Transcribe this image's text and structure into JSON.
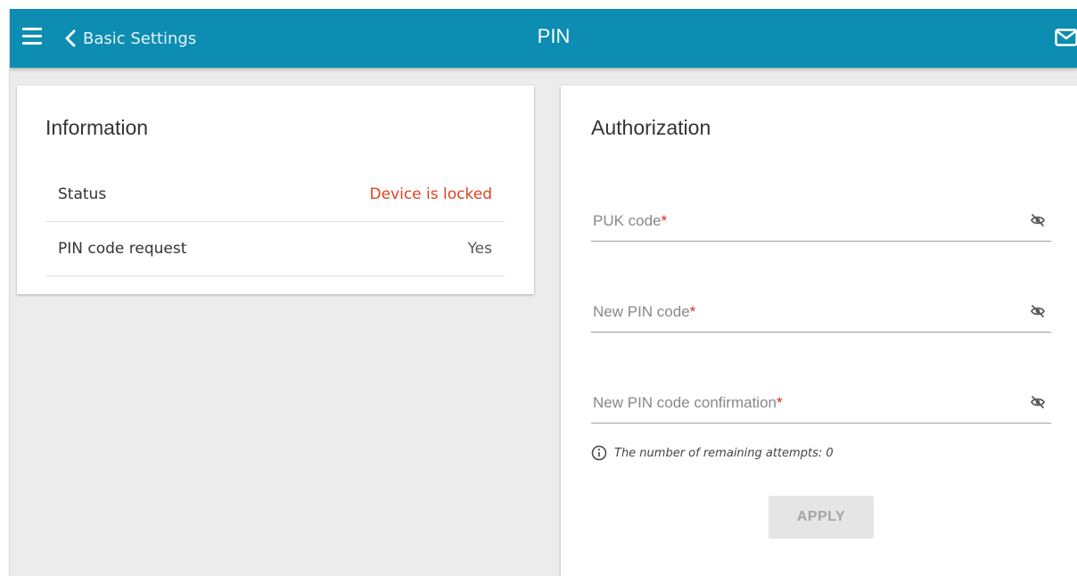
{
  "header": {
    "back_label": "Basic Settings",
    "title": "PIN",
    "icons": {
      "menu": "menu-icon",
      "back": "chevron-left-icon",
      "mail": "mail-icon"
    }
  },
  "info": {
    "title": "Information",
    "rows": [
      {
        "label": "Status",
        "value": "Device is locked"
      },
      {
        "label": "PIN code request",
        "value": "Yes"
      }
    ]
  },
  "auth": {
    "title": "Authorization",
    "fields": [
      {
        "placeholder": "PUK code",
        "required": "*"
      },
      {
        "placeholder": "New PIN code",
        "required": "*"
      },
      {
        "placeholder": "New PIN code confirmation",
        "required": "*"
      }
    ],
    "hint": "The number of remaining attempts: 0",
    "apply_label": "APPLY"
  },
  "colors": {
    "header": "#0c8db1",
    "background": "#ececec",
    "locked_status": "#e0401f",
    "required_mark": "#e02020",
    "apply_disabled": "#e5e5e5"
  }
}
